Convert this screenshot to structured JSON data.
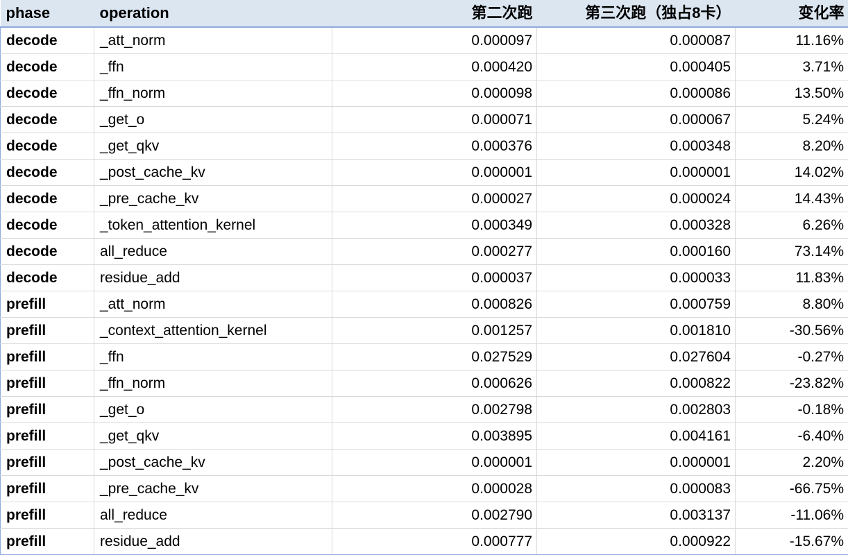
{
  "table": {
    "columns": [
      {
        "key": "phase",
        "label": "phase",
        "align": "left"
      },
      {
        "key": "operation",
        "label": "operation",
        "align": "left"
      },
      {
        "key": "run2",
        "label": "第二次跑",
        "align": "right"
      },
      {
        "key": "run3",
        "label": "第三次跑（独占8卡）",
        "align": "right"
      },
      {
        "key": "delta",
        "label": "变化率",
        "align": "right"
      }
    ],
    "rows": [
      {
        "phase": "decode",
        "operation": "_att_norm",
        "run2": "0.000097",
        "run3": "0.000087",
        "delta": "11.16%"
      },
      {
        "phase": "decode",
        "operation": "_ffn",
        "run2": "0.000420",
        "run3": "0.000405",
        "delta": "3.71%"
      },
      {
        "phase": "decode",
        "operation": "_ffn_norm",
        "run2": "0.000098",
        "run3": "0.000086",
        "delta": "13.50%"
      },
      {
        "phase": "decode",
        "operation": "_get_o",
        "run2": "0.000071",
        "run3": "0.000067",
        "delta": "5.24%"
      },
      {
        "phase": "decode",
        "operation": "_get_qkv",
        "run2": "0.000376",
        "run3": "0.000348",
        "delta": "8.20%"
      },
      {
        "phase": "decode",
        "operation": "_post_cache_kv",
        "run2": "0.000001",
        "run3": "0.000001",
        "delta": "14.02%"
      },
      {
        "phase": "decode",
        "operation": "_pre_cache_kv",
        "run2": "0.000027",
        "run3": "0.000024",
        "delta": "14.43%"
      },
      {
        "phase": "decode",
        "operation": "_token_attention_kernel",
        "run2": "0.000349",
        "run3": "0.000328",
        "delta": "6.26%"
      },
      {
        "phase": "decode",
        "operation": "all_reduce",
        "run2": "0.000277",
        "run3": "0.000160",
        "delta": "73.14%"
      },
      {
        "phase": "decode",
        "operation": "residue_add",
        "run2": "0.000037",
        "run3": "0.000033",
        "delta": "11.83%"
      },
      {
        "phase": "prefill",
        "operation": "_att_norm",
        "run2": "0.000826",
        "run3": "0.000759",
        "delta": "8.80%"
      },
      {
        "phase": "prefill",
        "operation": "_context_attention_kernel",
        "run2": "0.001257",
        "run3": "0.001810",
        "delta": "-30.56%"
      },
      {
        "phase": "prefill",
        "operation": "_ffn",
        "run2": "0.027529",
        "run3": "0.027604",
        "delta": "-0.27%"
      },
      {
        "phase": "prefill",
        "operation": "_ffn_norm",
        "run2": "0.000626",
        "run3": "0.000822",
        "delta": "-23.82%"
      },
      {
        "phase": "prefill",
        "operation": "_get_o",
        "run2": "0.002798",
        "run3": "0.002803",
        "delta": "-0.18%"
      },
      {
        "phase": "prefill",
        "operation": "_get_qkv",
        "run2": "0.003895",
        "run3": "0.004161",
        "delta": "-6.40%"
      },
      {
        "phase": "prefill",
        "operation": "_post_cache_kv",
        "run2": "0.000001",
        "run3": "0.000001",
        "delta": "2.20%"
      },
      {
        "phase": "prefill",
        "operation": "_pre_cache_kv",
        "run2": "0.000028",
        "run3": "0.000083",
        "delta": "-66.75%"
      },
      {
        "phase": "prefill",
        "operation": "all_reduce",
        "run2": "0.002790",
        "run3": "0.003137",
        "delta": "-11.06%"
      },
      {
        "phase": "prefill",
        "operation": "residue_add",
        "run2": "0.000777",
        "run3": "0.000922",
        "delta": "-15.67%"
      }
    ]
  },
  "colors": {
    "header_background": "#dce6f1",
    "header_accent_border": "#8ea9db",
    "grid_line": "#d9d9d9",
    "text": "#000000",
    "cell_background": "#ffffff"
  }
}
